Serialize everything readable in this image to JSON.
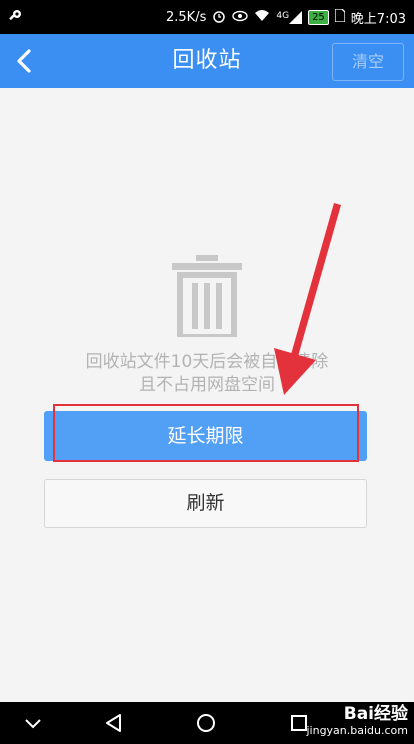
{
  "status_bar": {
    "speed": "2.5K/s",
    "signal": "4G",
    "battery": "25",
    "time": "晚上7:03",
    "icons": [
      "wrench-icon",
      "alarm-icon",
      "eye-icon",
      "wifi-icon",
      "signal-icon",
      "battery-icon",
      "sim-icon"
    ]
  },
  "header": {
    "title": "回收站",
    "clear_label": "清空",
    "back_icon": "chevron-left-icon"
  },
  "empty_state": {
    "icon": "trash-icon",
    "line1": "回收站文件10天后会被自动清除",
    "line2": "且不占用网盘空间"
  },
  "actions": {
    "extend_label": "延长期限",
    "refresh_label": "刷新"
  },
  "annotation": {
    "color": "#e4323c"
  },
  "nav_bar": {
    "icons": [
      "chevron-down-icon",
      "back-triangle-icon",
      "home-circle-icon",
      "recents-square-icon"
    ]
  },
  "watermark": {
    "brand": "Bai经验",
    "site": "jingyan.baidu.com"
  },
  "colors": {
    "header": "#3b8ff2",
    "primary_button": "#51a0f6",
    "hint_text": "#b3b3b3"
  }
}
